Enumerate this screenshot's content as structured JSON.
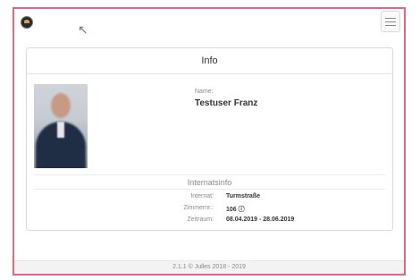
{
  "header": {
    "logo_icon": "app-logo-icon",
    "menu_icon": "hamburger-menu-icon"
  },
  "info_card": {
    "title": "Info",
    "profile": {
      "name_label": "Name:",
      "name_value": "Testuser Franz"
    },
    "internat": {
      "title": "Internatsinfo",
      "rows": [
        {
          "label": "Internat:",
          "value": "Turmstraße"
        },
        {
          "label": "Zimmernr.:",
          "value": "106 ⓘ"
        },
        {
          "label": "Zeitraum:",
          "value": "08.04.2019 - 28.06.2019"
        }
      ]
    }
  },
  "footer": {
    "text": "2.1.1 © Julles 2018 - 2019"
  }
}
